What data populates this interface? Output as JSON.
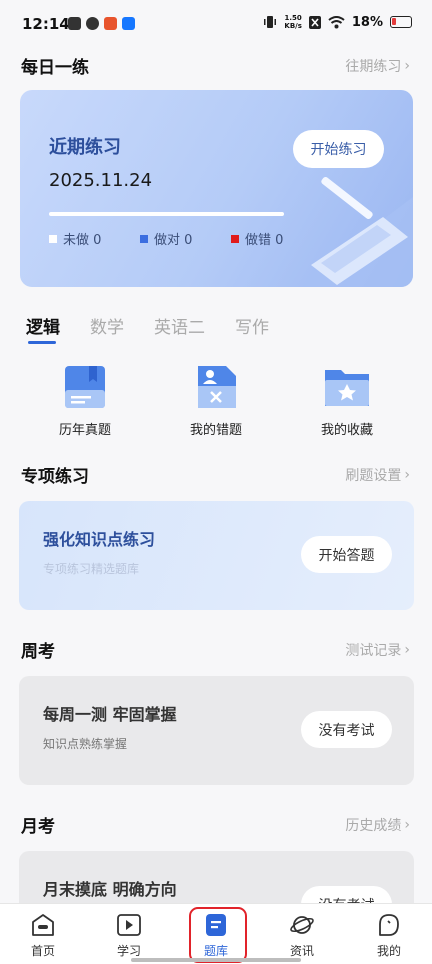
{
  "status_bar": {
    "time": "12:14",
    "speed_top": "1.50",
    "speed_bottom": "KB/s",
    "battery": "18%"
  },
  "daily": {
    "title": "每日一练",
    "link": "往期练习",
    "card": {
      "title": "近期练习",
      "date": "2025.11.24",
      "button": "开始练习",
      "legend": [
        {
          "label": "未做 0",
          "color": "#ffffff"
        },
        {
          "label": "做对 0",
          "color": "#3c6ee0"
        },
        {
          "label": "做错 0",
          "color": "#e01b1b"
        }
      ]
    }
  },
  "tabs": [
    "逻辑",
    "数学",
    "英语二",
    "写作"
  ],
  "entries": [
    {
      "label": "历年真题",
      "icon": "book-icon"
    },
    {
      "label": "我的错题",
      "icon": "wrong-question-icon"
    },
    {
      "label": "我的收藏",
      "icon": "favorites-folder-icon"
    }
  ],
  "special": {
    "title": "专项练习",
    "link": "刷题设置",
    "card_title": "强化知识点练习",
    "card_sub": "专项练习精选题库",
    "button": "开始答题"
  },
  "weekly": {
    "title": "周考",
    "link": "测试记录",
    "card_title": "每周一测 牢固掌握",
    "card_sub": "知识点熟练掌握",
    "button": "没有考试"
  },
  "monthly": {
    "title": "月考",
    "link": "历史成绩",
    "card_title": "月末摸底 明确方向",
    "button": "没有考试"
  },
  "nav": [
    {
      "label": "首页",
      "icon": "home-icon"
    },
    {
      "label": "学习",
      "icon": "play-icon"
    },
    {
      "label": "题库",
      "icon": "question-bank-icon"
    },
    {
      "label": "资讯",
      "icon": "planet-icon"
    },
    {
      "label": "我的",
      "icon": "profile-icon"
    }
  ],
  "colors": {
    "accent": "#2e66d8",
    "highlight": "#e1232a"
  }
}
